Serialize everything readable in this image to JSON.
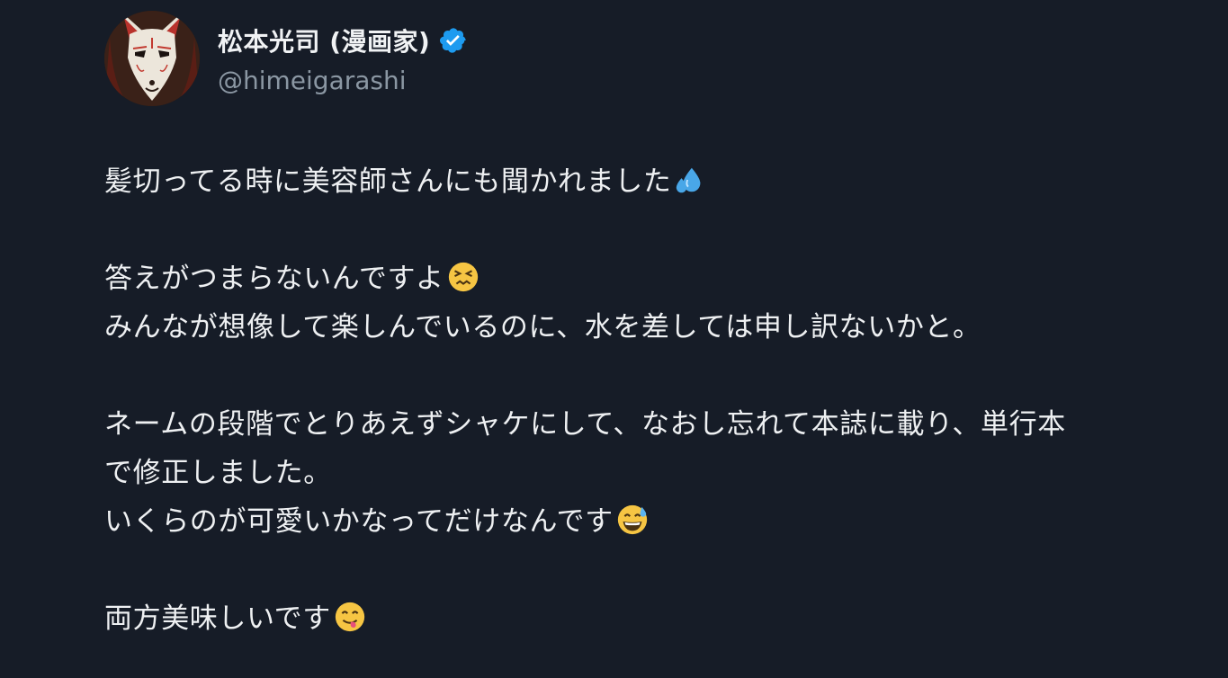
{
  "author": {
    "display_name": "松本光司 (漫画家)",
    "handle": "@himeigarashi",
    "avatar": "fox-mask-avatar",
    "verified_icon": "verified-badge-icon",
    "verified_color": "#1d9bf0"
  },
  "tweet": {
    "line1": "髪切ってる時に美容師さんにも聞かれました",
    "line1_emoji": "sweat-droplets-emoji",
    "line2": "答えがつまらないんですよ",
    "line2_emoji": "confounded-face-emoji",
    "line3": "みんなが想像して楽しんでいるのに、水を差しては申し訳ないかと。",
    "line4": "ネームの段階でとりあえずシャケにして、なおし忘れて本誌に載り、単行本",
    "line5": "で修正しました。",
    "line6": "いくらのが可愛いかなってだけなんです",
    "line6_emoji": "grinning-sweat-face-emoji",
    "line7": "両方美味しいです",
    "line7_emoji": "savoring-food-face-emoji"
  },
  "colors": {
    "background": "#161c27",
    "text": "#eef0f2",
    "handle": "#8b97a3"
  }
}
